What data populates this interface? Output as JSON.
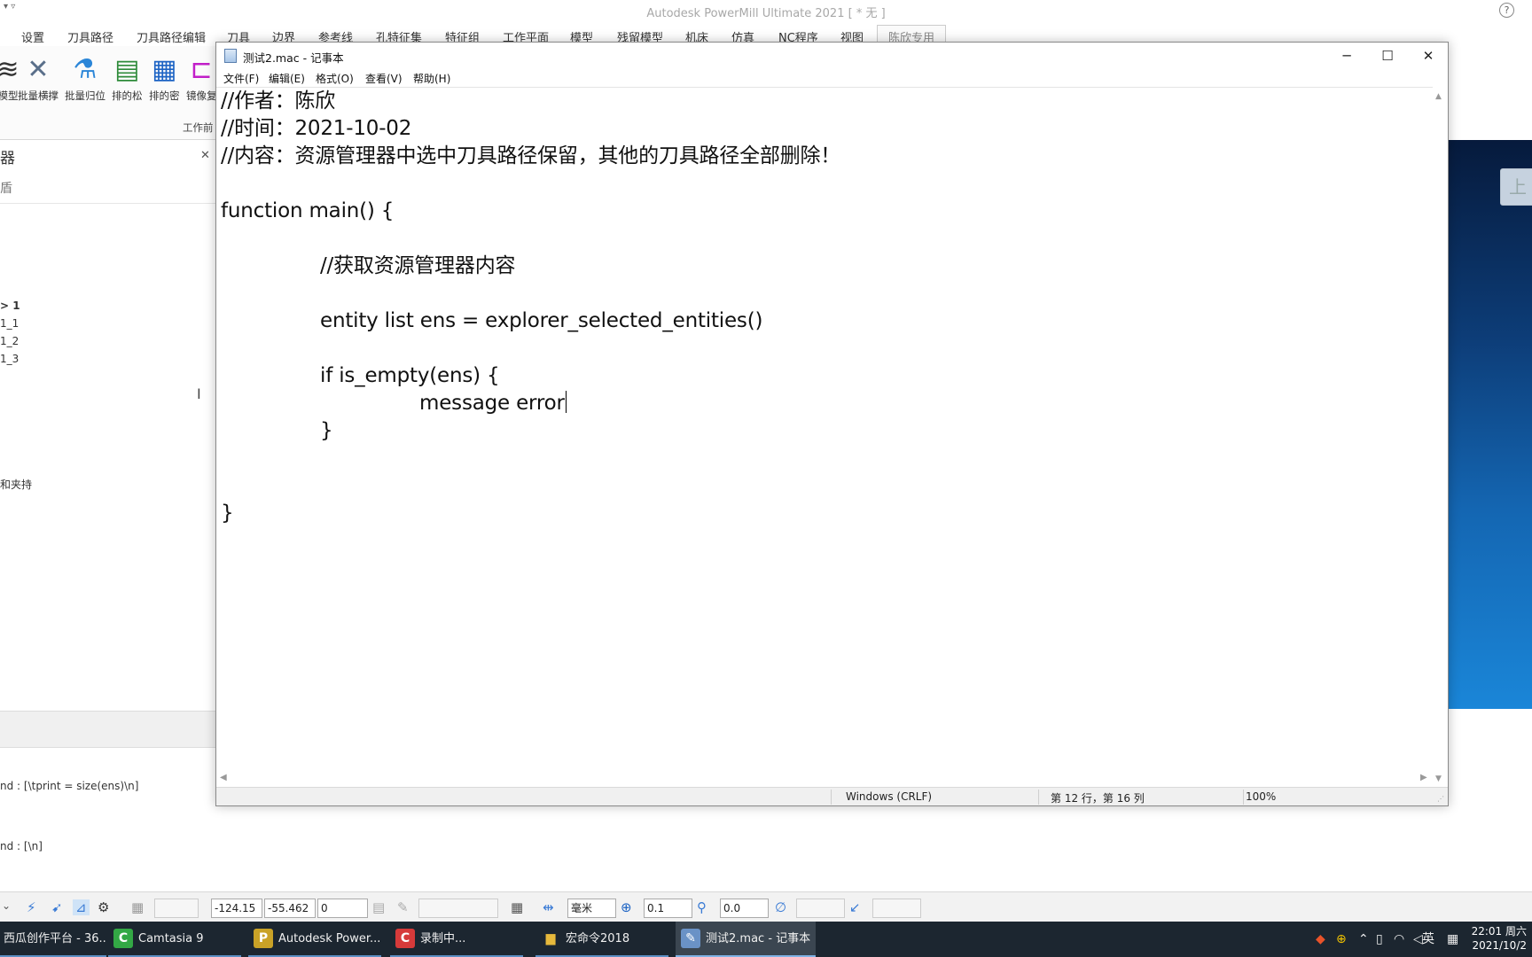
{
  "powermill": {
    "window_title": "Autodesk PowerMill Ultimate 2021    [ * 无 ]",
    "quick_access": "▾ ▿",
    "ribbon_tabs": [
      "设置",
      "刀具路径",
      "刀具路径编辑",
      "刀具",
      "边界",
      "参考线",
      "孔特征集",
      "特征组",
      "工作平面",
      "模型",
      "残留模型",
      "机床",
      "仿真",
      "NC程序",
      "视图",
      "陈欣专用"
    ],
    "ribbon_buttons": [
      "模型",
      "批量横撑",
      "批量归位",
      "排的松",
      "排的密",
      "镜像复"
    ],
    "ribbon_group_label": "工作前",
    "explorer_header": "器",
    "explorer_toolbar_glyph": "盾",
    "tree_items": [
      "> 1",
      "1_1",
      "1_2",
      "1_3"
    ],
    "tree_item_extra": "和夹持",
    "command_lines": [
      "nd : [\\tprint = size(ens)\\n]",
      "nd : [\\n]"
    ],
    "viewport_button": "上",
    "status_fields": [
      "-124.15",
      "-55.462",
      "0",
      "毫米",
      "0.1",
      "0.0"
    ]
  },
  "taskbar": {
    "items": [
      {
        "label": "西瓜创作平台 - 36...",
        "icon": "西",
        "color": "#e23b3b"
      },
      {
        "label": "Camtasia 9",
        "icon": "C",
        "color": "#33a845"
      },
      {
        "label": "Autodesk Power...",
        "icon": "P",
        "color": "#c9a227"
      },
      {
        "label": "录制中...",
        "icon": "C",
        "color": "#d63a3a"
      },
      {
        "label": "宏命令2018",
        "icon": "▆",
        "color": "#e6b93c"
      },
      {
        "label": "测试2.mac - 记事本",
        "icon": "✎",
        "color": "#6a92c6"
      }
    ],
    "tray_lang": "英",
    "clock_time": "22:01 周六",
    "clock_date": "2021/10/2"
  },
  "notepad": {
    "title": "测试2.mac - 记事本",
    "menu": [
      "文件(F)",
      "编辑(E)",
      "格式(O)",
      "查看(V)",
      "帮助(H)"
    ],
    "lines": [
      "//作者：陈欣",
      "//时间：2021-10-02",
      "//内容：资源管理器中选中刀具路径保留，其他的刀具路径全部删除！",
      "",
      "function main() {",
      "",
      "\t//获取资源管理器内容",
      "",
      "\tentity list ens = explorer_selected_entities()",
      "",
      "\tif is_empty(ens) {",
      "\t\tmessage error",
      "\t}",
      "",
      "",
      "}"
    ],
    "status": {
      "encoding": "Windows (CRLF)",
      "position": "第 12 行，第 16 列",
      "zoom": "100%"
    }
  }
}
